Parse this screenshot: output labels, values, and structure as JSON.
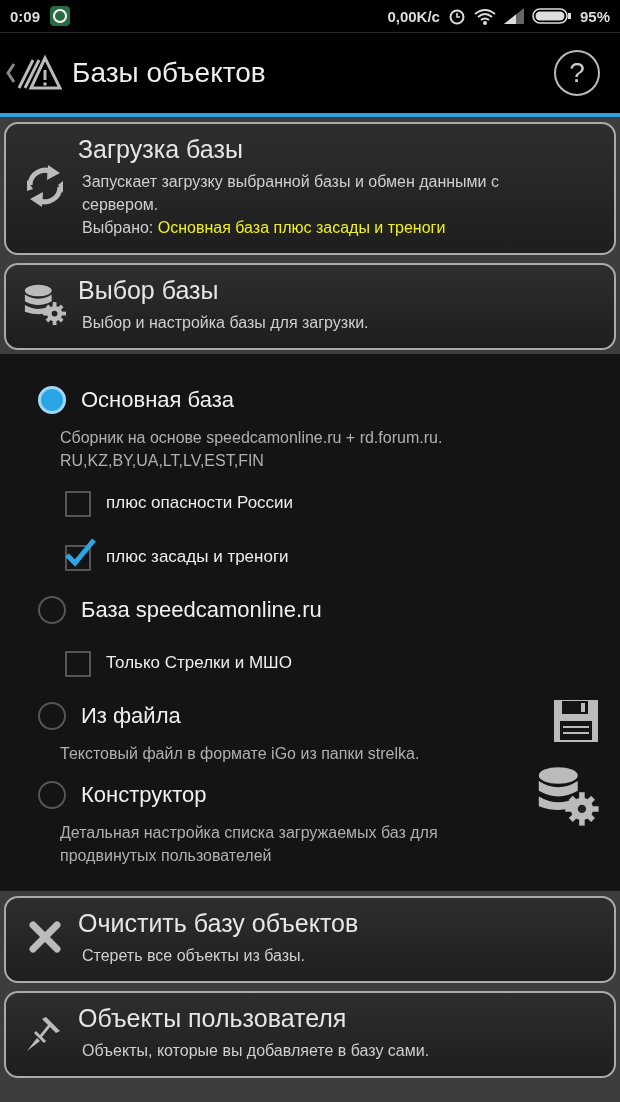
{
  "status_bar": {
    "time": "0:09",
    "network_speed": "0,00K/c",
    "battery": "95%"
  },
  "header": {
    "title": "Базы объектов",
    "help_label": "?"
  },
  "top_actions": [
    {
      "title": "Загрузка базы",
      "description": "Запускает загрузку выбранной базы и обмен данными с сервером.",
      "selection": {
        "label": "Выбрано:",
        "value": "Основная база плюс засады и треноги"
      }
    },
    {
      "title": "Выбор базы",
      "description": "Выбор и настройка базы для загрузки."
    }
  ],
  "database_options": [
    {
      "label": "Основная база",
      "selected": true,
      "description": "Сборник на основе speedcamonline.ru + rd.forum.ru. RU,KZ,BY,UA,LT,LV,EST,FIN",
      "suboptions": [
        {
          "label": "плюс опасности России",
          "checked": false
        },
        {
          "label": "плюс засады и треноги",
          "checked": true
        }
      ]
    },
    {
      "label": "База speedcamonline.ru",
      "selected": false,
      "suboptions": [
        {
          "label": "Только Стрелки и МШО",
          "checked": false
        }
      ]
    },
    {
      "label": "Из файла",
      "selected": false,
      "description": "Текстовый файл в формате iGo из папки strelka."
    },
    {
      "label": "Конструктор",
      "selected": false,
      "description": "Детальная настройка списка загружаемых баз для продвинутых пользователей"
    }
  ],
  "bottom_actions": [
    {
      "title": "Очистить базу объектов",
      "description": "Стереть все объекты из базы."
    },
    {
      "title": "Объекты пользователя",
      "description": "Объекты, которые вы добавляете в базу сами."
    }
  ]
}
